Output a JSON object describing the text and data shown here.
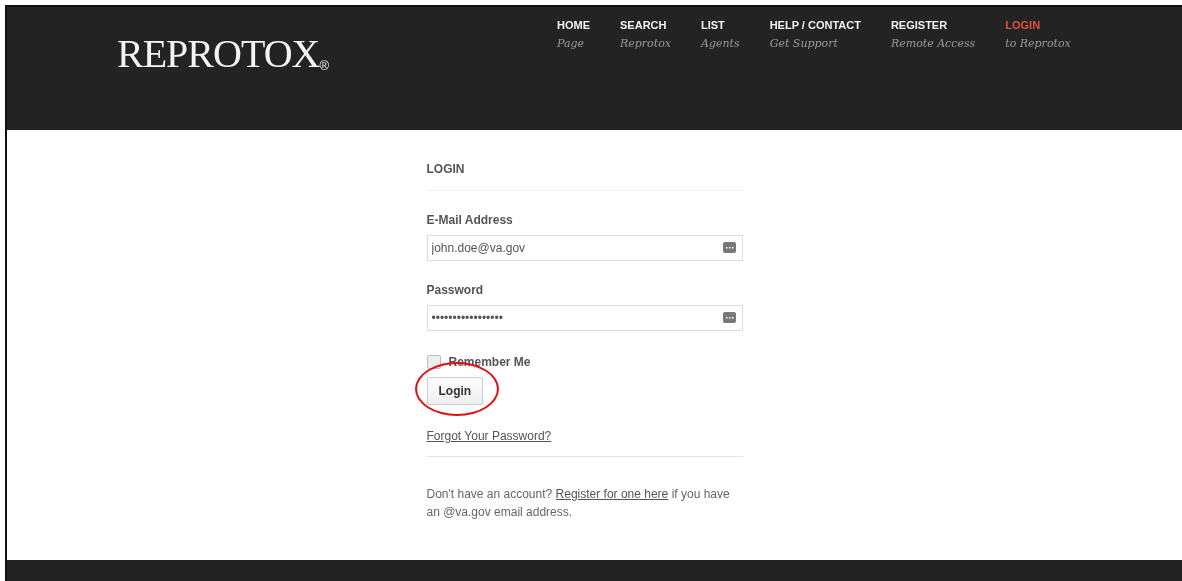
{
  "header": {
    "logo": "REPROTOX",
    "logo_mark": "®",
    "nav": [
      {
        "label": "HOME",
        "sub": "Page",
        "selected": false
      },
      {
        "label": "SEARCH",
        "sub": "Reprotox",
        "selected": false
      },
      {
        "label": "LIST",
        "sub": "Agents",
        "selected": false
      },
      {
        "label": "HELP / CONTACT",
        "sub": "Get Support",
        "selected": false
      },
      {
        "label": "REGISTER",
        "sub": "Remote Access",
        "selected": false
      },
      {
        "label": "LOGIN",
        "sub": "to Reprotox",
        "selected": true
      }
    ]
  },
  "form": {
    "title": "LOGIN",
    "fields": [
      {
        "label": "E-Mail Address",
        "value": "john.doe@va.gov"
      },
      {
        "label": "Password",
        "value": "•••••••••••••••••"
      }
    ],
    "remember": {
      "label": "Remember Me",
      "checked": false
    },
    "button": "Login",
    "forgot": "Forgot Your Password?",
    "note": {
      "before": "Don't have an account?",
      "link": "Register for one here",
      "after": "if you have an @va.gov email address."
    }
  }
}
